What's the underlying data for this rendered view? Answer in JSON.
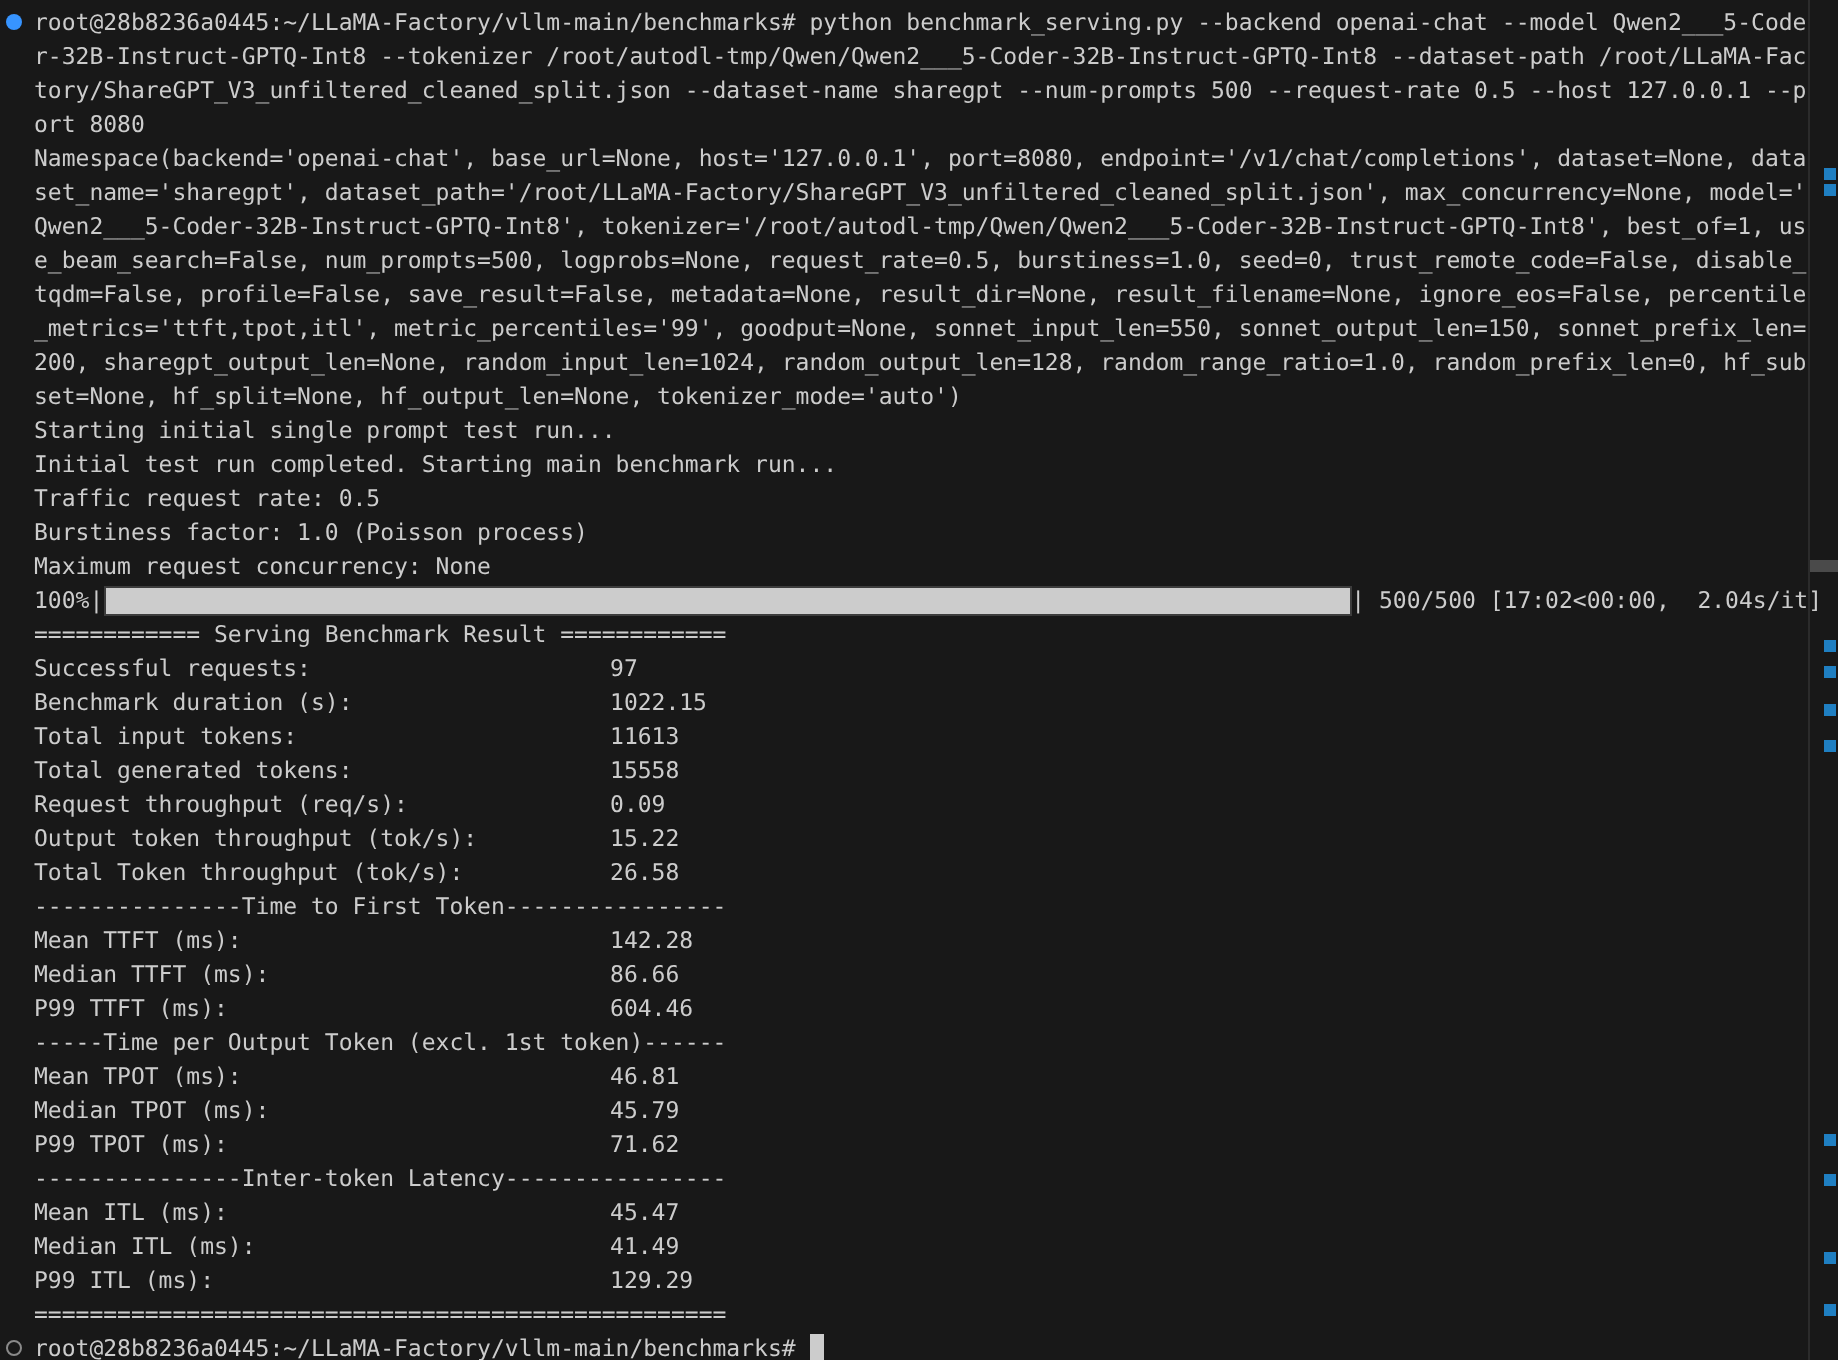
{
  "terminal": {
    "lines": [
      {
        "kind": "prompt",
        "completed": true,
        "text": "root@28b8236a0445:~/LLaMA-Factory/vllm-main/benchmarks# python benchmark_serving.py --backend openai-chat --model Qwen2___5-Code"
      },
      {
        "kind": "text",
        "text": "r-32B-Instruct-GPTQ-Int8 --tokenizer /root/autodl-tmp/Qwen/Qwen2___5-Coder-32B-Instruct-GPTQ-Int8 --dataset-path /root/LLaMA-Fac"
      },
      {
        "kind": "text",
        "text": "tory/ShareGPT_V3_unfiltered_cleaned_split.json --dataset-name sharegpt --num-prompts 500 --request-rate 0.5 --host 127.0.0.1 --p"
      },
      {
        "kind": "text",
        "text": "ort 8080"
      },
      {
        "kind": "text",
        "text": "Namespace(backend='openai-chat', base_url=None, host='127.0.0.1', port=8080, endpoint='/v1/chat/completions', dataset=None, data"
      },
      {
        "kind": "text",
        "text": "set_name='sharegpt', dataset_path='/root/LLaMA-Factory/ShareGPT_V3_unfiltered_cleaned_split.json', max_concurrency=None, model='"
      },
      {
        "kind": "text",
        "text": "Qwen2___5-Coder-32B-Instruct-GPTQ-Int8', tokenizer='/root/autodl-tmp/Qwen/Qwen2___5-Coder-32B-Instruct-GPTQ-Int8', best_of=1, us"
      },
      {
        "kind": "text",
        "text": "e_beam_search=False, num_prompts=500, logprobs=None, request_rate=0.5, burstiness=1.0, seed=0, trust_remote_code=False, disable_"
      },
      {
        "kind": "text",
        "text": "tqdm=False, profile=False, save_result=False, metadata=None, result_dir=None, result_filename=None, ignore_eos=False, percentile"
      },
      {
        "kind": "text",
        "text": "_metrics='ttft,tpot,itl', metric_percentiles='99', goodput=None, sonnet_input_len=550, sonnet_output_len=150, sonnet_prefix_len="
      },
      {
        "kind": "text",
        "text": "200, sharegpt_output_len=None, random_input_len=1024, random_output_len=128, random_range_ratio=1.0, random_prefix_len=0, hf_sub"
      },
      {
        "kind": "text",
        "text": "set=None, hf_split=None, hf_output_len=None, tokenizer_mode='auto')"
      },
      {
        "kind": "text",
        "text": "Starting initial single prompt test run..."
      },
      {
        "kind": "text",
        "text": "Initial test run completed. Starting main benchmark run..."
      },
      {
        "kind": "text",
        "text": "Traffic request rate: 0.5"
      },
      {
        "kind": "text",
        "text": "Burstiness factor: 1.0 (Poisson process)"
      },
      {
        "kind": "text",
        "text": "Maximum request concurrency: None"
      },
      {
        "kind": "progress",
        "prefix": "100%|",
        "level": 1.0,
        "suffix": "| 500/500 [17:02<00:00,  2.04s/it]"
      },
      {
        "kind": "text",
        "text": "============ Serving Benchmark Result ============"
      },
      {
        "kind": "metric",
        "label": "Successful requests:",
        "value": "97"
      },
      {
        "kind": "metric",
        "label": "Benchmark duration (s):",
        "value": "1022.15"
      },
      {
        "kind": "metric",
        "label": "Total input tokens:",
        "value": "11613"
      },
      {
        "kind": "metric",
        "label": "Total generated tokens:",
        "value": "15558"
      },
      {
        "kind": "metric",
        "label": "Request throughput (req/s):",
        "value": "0.09"
      },
      {
        "kind": "metric",
        "label": "Output token throughput (tok/s):",
        "value": "15.22"
      },
      {
        "kind": "metric",
        "label": "Total Token throughput (tok/s):",
        "value": "26.58"
      },
      {
        "kind": "text",
        "text": "---------------Time to First Token----------------"
      },
      {
        "kind": "metric",
        "label": "Mean TTFT (ms):",
        "value": "142.28"
      },
      {
        "kind": "metric",
        "label": "Median TTFT (ms):",
        "value": "86.66"
      },
      {
        "kind": "metric",
        "label": "P99 TTFT (ms):",
        "value": "604.46"
      },
      {
        "kind": "text",
        "text": "-----Time per Output Token (excl. 1st token)------"
      },
      {
        "kind": "metric",
        "label": "Mean TPOT (ms):",
        "value": "46.81"
      },
      {
        "kind": "metric",
        "label": "Median TPOT (ms):",
        "value": "45.79"
      },
      {
        "kind": "metric",
        "label": "P99 TPOT (ms):",
        "value": "71.62"
      },
      {
        "kind": "text",
        "text": "---------------Inter-token Latency----------------"
      },
      {
        "kind": "metric",
        "label": "Mean ITL (ms):",
        "value": "45.47"
      },
      {
        "kind": "metric",
        "label": "Median ITL (ms):",
        "value": "41.49"
      },
      {
        "kind": "metric",
        "label": "P99 ITL (ms):",
        "value": "129.29"
      },
      {
        "kind": "text",
        "text": "=================================================="
      },
      {
        "kind": "prompt",
        "completed": false,
        "cursor": true,
        "text": "root@28b8236a0445:~/LLaMA-Factory/vllm-main/benchmarks#"
      }
    ]
  }
}
